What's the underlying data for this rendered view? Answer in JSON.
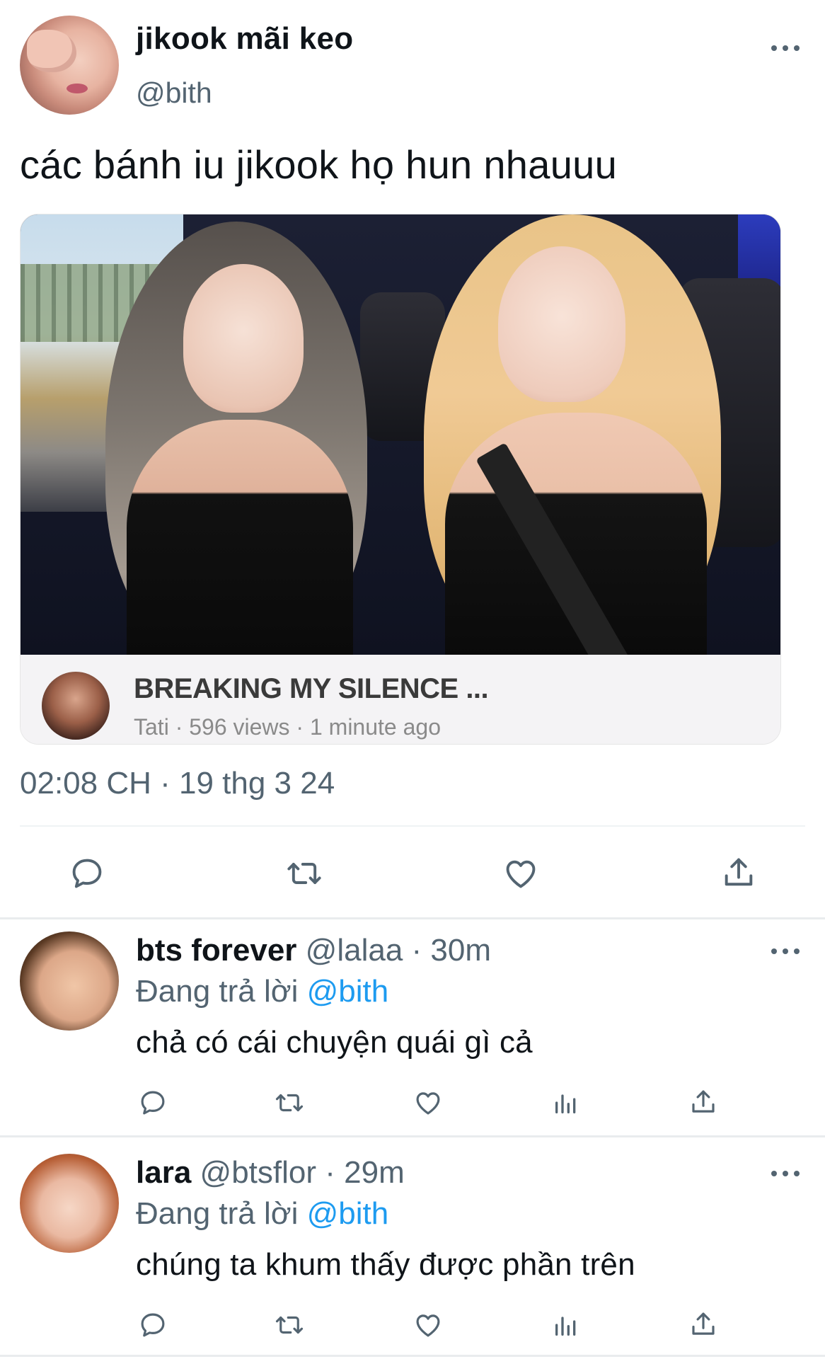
{
  "tweet": {
    "author_name": "jikook mãi keo",
    "author_handle": "@bith",
    "text": "các bánh iu jikook họ hun nhauuu",
    "media": {
      "video_title": "BREAKING MY SILENCE ...",
      "channel": "Tati",
      "views": "596 views",
      "time_ago": "1 minute ago"
    },
    "timestamp": "02:08 CH · 19 thg 3 24"
  },
  "replies": [
    {
      "name": "bts forever",
      "handle": "@lalaa",
      "separator": "·",
      "time": "30m",
      "replying_prefix": "Đang trả lời",
      "replying_to": "@bith",
      "text": "chả có cái chuyện quái gì cả"
    },
    {
      "name": "lara",
      "handle": "@btsflor",
      "separator": "·",
      "time": "29m",
      "replying_prefix": "Đang trả lời",
      "replying_to": "@bith",
      "text": "chúng ta khum thấy được phần trên"
    }
  ],
  "icons": {
    "reply": "reply-icon",
    "retweet": "retweet-icon",
    "like": "heart-icon",
    "views": "views-icon",
    "share": "share-icon",
    "more": "more-icon"
  },
  "colors": {
    "link": "#1d9bf0",
    "secondary_text": "#536471",
    "primary_text": "#0f1419"
  }
}
